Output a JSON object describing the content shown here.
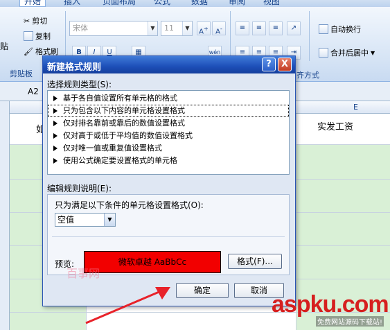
{
  "ribbon": {
    "tabs": [
      "开始",
      "插入",
      "页面布局",
      "公式",
      "数据",
      "审阅",
      "视图"
    ],
    "clipboard": {
      "paste_label": "贴",
      "cut_label": "剪切",
      "copy_label": "复制",
      "format_painter_label": "格式刷",
      "group_label": "剪贴板"
    },
    "font": {
      "name_value": "宋体",
      "size_value": "11"
    },
    "alignment": {
      "wrap_label": "自动换行",
      "merge_label": "合并后居中",
      "group_label": "齐方式"
    }
  },
  "sheet": {
    "name_box": "A2",
    "columns": [
      "E"
    ],
    "header_e": "实发工资",
    "header_b_fragment": "如"
  },
  "dialog": {
    "title": "新建格式规则",
    "select_type_label": "选择规则类型(S):",
    "rules": [
      "基于各自值设置所有单元格的格式",
      "只为包含以下内容的单元格设置格式",
      "仅对排名靠前或靠后的数值设置格式",
      "仅对高于或低于平均值的数值设置格式",
      "仅对唯一值或重复值设置格式",
      "使用公式确定要设置格式的单元格"
    ],
    "edit_desc_label": "编辑规则说明(E):",
    "condition_label": "只为满足以下条件的单元格设置格式(O):",
    "condition_value": "空值",
    "preview_label": "预览:",
    "preview_text": "微软卓越  AaBbCc",
    "format_button": "格式(F)...",
    "ok_button": "确定",
    "cancel_button": "取消",
    "help_button": "?",
    "close_button": "X"
  },
  "watermarks": {
    "site": "aspku.com",
    "sub": "免费网站源码下载站!",
    "cn": "百事网"
  },
  "colors": {
    "preview_fill": "#f20000",
    "titlebar": "#1d4fb8",
    "column_fill": "#d9f0d6"
  }
}
